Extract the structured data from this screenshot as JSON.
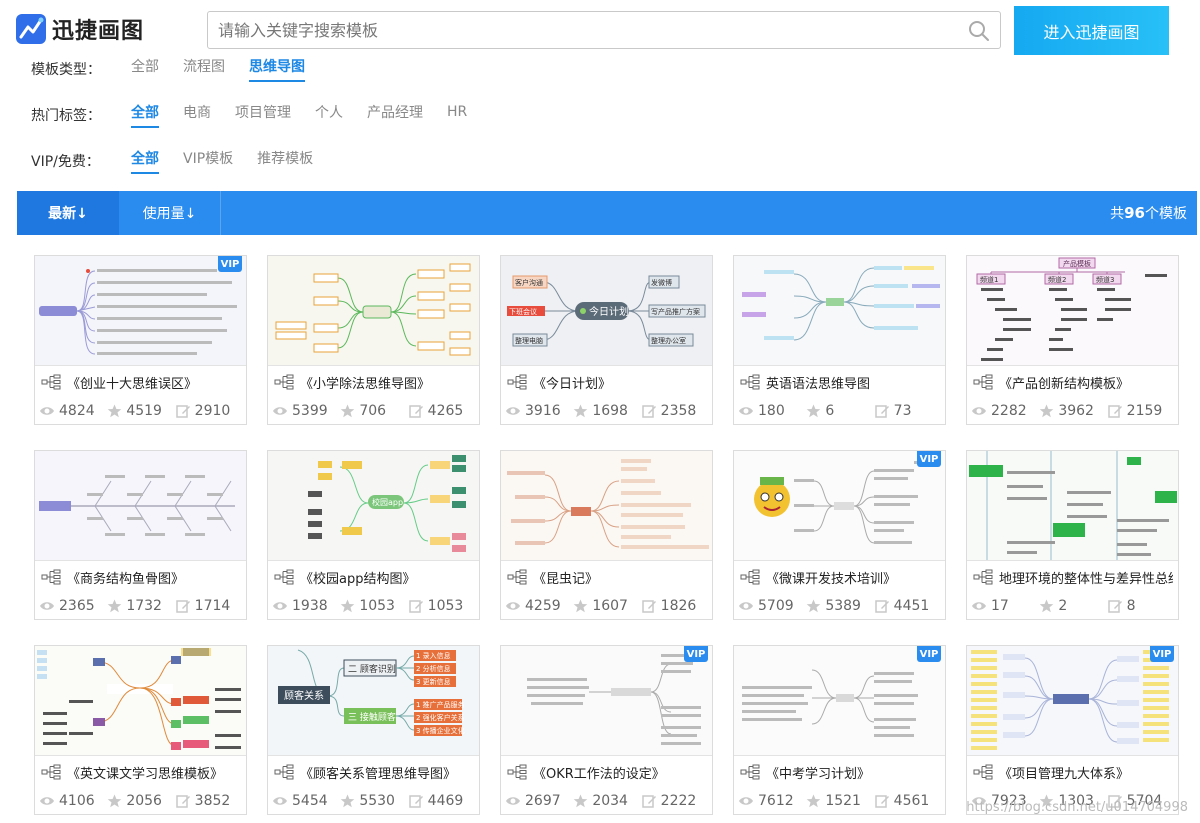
{
  "header": {
    "logo_text": "迅捷画图",
    "search_placeholder": "请输入关键字搜索模板",
    "enter_button": "进入迅捷画图"
  },
  "filters": [
    {
      "label": "模板类型：",
      "options": [
        "全部",
        "流程图",
        "思维导图"
      ],
      "active": 2
    },
    {
      "label": "热门标签：",
      "options": [
        "全部",
        "电商",
        "项目管理",
        "个人",
        "产品经理",
        "HR"
      ],
      "active": 0
    },
    {
      "label": "VIP/免费：",
      "options": [
        "全部",
        "VIP模板",
        "推荐模板"
      ],
      "active": 0
    }
  ],
  "sort": {
    "latest": "最新↓",
    "usage": "使用量↓",
    "total_prefix": "共",
    "total_count": "96",
    "total_suffix": "个模板"
  },
  "cards": [
    {
      "title": "《创业十大思维误区》",
      "views": "4824",
      "likes": "4519",
      "edits": "2910",
      "vip": true
    },
    {
      "title": "《小学除法思维导图》",
      "views": "5399",
      "likes": "706",
      "edits": "4265",
      "vip": false
    },
    {
      "title": "《今日计划》",
      "views": "3916",
      "likes": "1698",
      "edits": "2358",
      "vip": false
    },
    {
      "title": "英语语法思维导图",
      "views": "180",
      "likes": "6",
      "edits": "73",
      "vip": false
    },
    {
      "title": "《产品创新结构模板》",
      "views": "2282",
      "likes": "3962",
      "edits": "2159",
      "vip": false
    },
    {
      "title": "《商务结构鱼骨图》",
      "views": "2365",
      "likes": "1732",
      "edits": "1714",
      "vip": false
    },
    {
      "title": "《校园app结构图》",
      "views": "1938",
      "likes": "1053",
      "edits": "1053",
      "vip": false
    },
    {
      "title": "《昆虫记》",
      "views": "4259",
      "likes": "1607",
      "edits": "1826",
      "vip": false
    },
    {
      "title": "《微课开发技术培训》",
      "views": "5709",
      "likes": "5389",
      "edits": "4451",
      "vip": true
    },
    {
      "title": "地理环境的整体性与差异性总结",
      "views": "17",
      "likes": "2",
      "edits": "8",
      "vip": false
    },
    {
      "title": "《英文课文学习思维模板》",
      "views": "4106",
      "likes": "2056",
      "edits": "3852",
      "vip": false
    },
    {
      "title": "《顾客关系管理思维导图》",
      "views": "5454",
      "likes": "5530",
      "edits": "4469",
      "vip": false
    },
    {
      "title": "《OKR工作法的设定》",
      "views": "2697",
      "likes": "2034",
      "edits": "2222",
      "vip": true
    },
    {
      "title": "《中考学习计划》",
      "views": "7612",
      "likes": "1521",
      "edits": "4561",
      "vip": true
    },
    {
      "title": "《项目管理九大体系》",
      "views": "7923",
      "likes": "1303",
      "edits": "5704",
      "vip": true
    }
  ],
  "thumb_text": {
    "plan_center": "今日计划",
    "plan_b1": "客户沟通",
    "plan_b2": "下班会议",
    "plan_b3": "整理电脑",
    "plan_b4": "发微博",
    "plan_b5": "写产品推广方案",
    "plan_b6": "整理办公室",
    "prod_root": "产品模板",
    "prod_c1": "频道1",
    "prod_c2": "频道2",
    "prod_c3": "频道3",
    "app_center": "校园app",
    "cust_center": "顾客关系",
    "cust_b1": "二 顾客识别",
    "cust_b2": "三 接触顾客",
    "cust_l1": "1 录入信息",
    "cust_l2": "2 分析信息",
    "cust_l3": "3 更新信息",
    "cust_l4": "1 推广产品服务",
    "cust_l5": "2 强化客户关系",
    "cust_l6": "3 传播企业文化"
  },
  "vip_badge": "VIP",
  "watermark": "https://blog.csdn.net/u014704998"
}
